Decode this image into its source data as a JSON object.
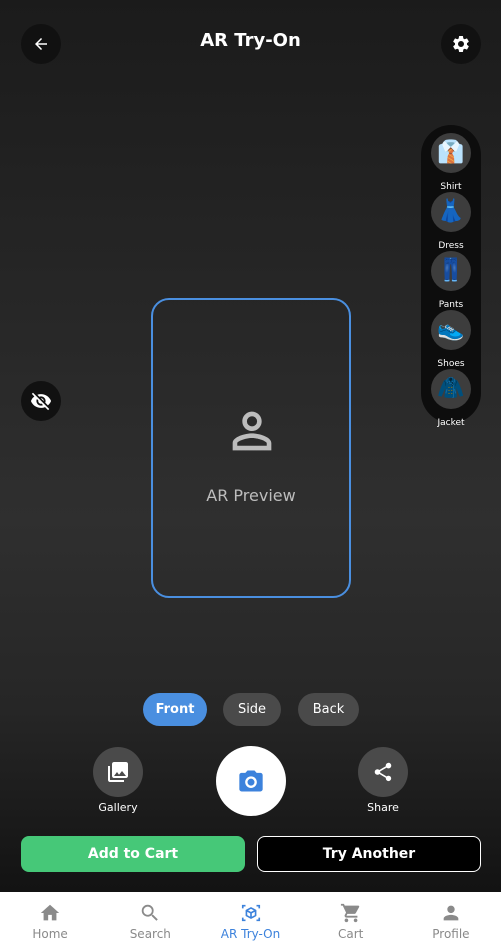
{
  "header": {
    "title": "AR Try-On"
  },
  "garments": [
    {
      "label": "Shirt",
      "icon": "shirt-icon",
      "glyph": "👔"
    },
    {
      "label": "Dress",
      "icon": "dress-icon",
      "glyph": "👗"
    },
    {
      "label": "Pants",
      "icon": "pants-icon",
      "glyph": "👖"
    },
    {
      "label": "Shoes",
      "icon": "shoes-icon",
      "glyph": "👟"
    },
    {
      "label": "Jacket",
      "icon": "jacket-icon",
      "glyph": "🧥"
    }
  ],
  "preview": {
    "label": "AR Preview"
  },
  "views": [
    {
      "label": "Front",
      "active": true
    },
    {
      "label": "Side",
      "active": false
    },
    {
      "label": "Back",
      "active": false
    }
  ],
  "actions": {
    "gallery": "Gallery",
    "share": "Share"
  },
  "buttons": {
    "add_to_cart": "Add to Cart",
    "try_another": "Try Another"
  },
  "nav": [
    {
      "label": "Home",
      "icon": "home-icon"
    },
    {
      "label": "Search",
      "icon": "search-icon"
    },
    {
      "label": "AR Try-On",
      "icon": "ar-icon",
      "active": true
    },
    {
      "label": "Cart",
      "icon": "cart-icon"
    },
    {
      "label": "Profile",
      "icon": "profile-icon"
    }
  ],
  "colors": {
    "accent": "#4a8fe0",
    "cart_green": "#46c878",
    "nav_active": "#3c82dc"
  }
}
